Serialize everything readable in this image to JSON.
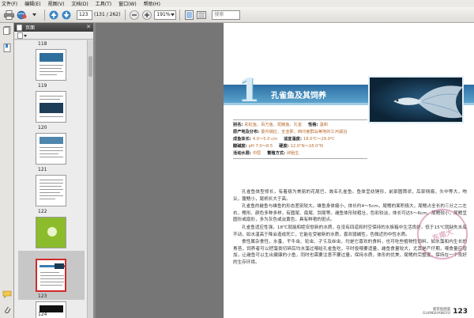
{
  "menu": {
    "items": [
      "文件(F)",
      "编辑(E)",
      "视图(V)",
      "文档(D)",
      "工具(T)",
      "窗口(W)",
      "帮助(H)"
    ]
  },
  "toolbar": {
    "page_value": "123",
    "page_info": "(131 / 262)",
    "zoom_value": "191%",
    "search_placeholder": "搜索"
  },
  "panel": {
    "title": "页面",
    "thumbnails": [
      {
        "label": "118"
      },
      {
        "label": "119"
      },
      {
        "label": "120"
      },
      {
        "label": "121"
      },
      {
        "label": "122"
      },
      {
        "label": "123"
      },
      {
        "label": "124"
      }
    ]
  },
  "document": {
    "chapter_number": "1",
    "chapter_title": "孔雀鱼及其饲养",
    "info": [
      {
        "k": "别名:",
        "v": "彩虹鱼、百万鱼、斑鳍鱼、孔雀",
        "k2": "性格:",
        "v2": "温和"
      },
      {
        "k": "原产地及分布:",
        "v": "委内瑞拉、圭亚那、西印度群岛等地的江河湖泊",
        "k2": "",
        "v2": ""
      },
      {
        "k": "成鱼体长:",
        "v": "4.0～5.0 cm",
        "k2": "适宜温度:",
        "v2": "18.0℃～29.0℃"
      },
      {
        "k": "酸碱度:",
        "v": "pH 7.0～8.5",
        "k2": "硬度:",
        "v2": "12.0°N～18.0°N"
      },
      {
        "k": "活动水层:",
        "v": "中层",
        "k2": "繁殖方式:",
        "v2": "卵胎生"
      }
    ],
    "paragraphs": [
      "孔雀鱼体型修长，有着极为美丽的花尾巴，故名孔雀鱼。鱼体呈纺锤形，前部圆筒状，后部侧扁，头中等大，吻尖，腹鳍小，尾柄长大于高。",
      "孔雀鱼的雌鱼与雄鱼的形态差别较大。雄鱼身体瘦小，体长约4～5cm，尾鳍的面积极大，尾鳍占全长的三分之二左右，鳍形、颜色多种多样，有圆尾、扇尾、剑尾等。雌鱼体形较粗壮，色彩较淡，体长可达5～6cm，尾鳍较小，尾鳍呈圆形或扇形，多为灰色或淡黄色，具有鲜艳的斑点。",
      "孔雀鱼适应性强，18℃就能和睦安慰新的水质，在没有四道和时空保持的水族箱中生活良好，低于15℃就缺失水底不动，如水温高于降会造成死亡，它能在受被新的水质，喜欢弱碱性，色微近的中性水质。",
      "食性属杂食性，水蚤、干牛虫、轮虫、孑孓及丝虫，均是它喜欢的食料，也可吃些植物性饲料，如水藻和内生长的青苔，饲养者可以把藻类切碎后均水藻过喂给孔雀鱼吃，平时投喂要适量，雌鱼食量较大，尤其是产仔期，喂食量应增加，让雌鱼可以生出健康的小鱼，同时也需要注意不要过量，保持水质，体形的优美，尾鳍的完整度，保持在一个良好的生存环境。"
    ],
    "footer_name": "观赏鱼图鉴\nGUANSHANGYU",
    "footer_page": "123",
    "stamp_text": "东南大"
  }
}
